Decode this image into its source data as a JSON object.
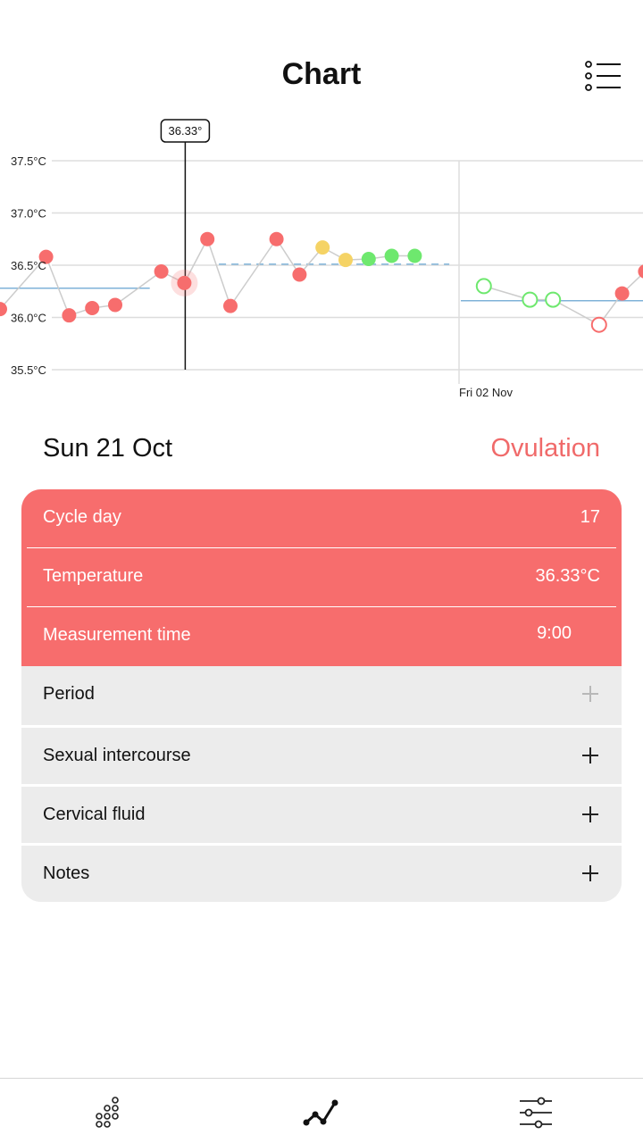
{
  "header": {
    "title": "Chart",
    "menu_icon": "list-menu-icon"
  },
  "chart_data": {
    "type": "scatter",
    "y_tick_labels": [
      "37.5°C",
      "37.0°C",
      "36.5°C",
      "36.0°C",
      "35.5°C"
    ],
    "y_ticks": [
      37.5,
      37.0,
      36.5,
      36.0,
      35.5
    ],
    "ylim": [
      35.5,
      37.7
    ],
    "x_marker_label": "Fri 02 Nov",
    "selected_value_label": "36.33°",
    "selected_day_index": 8,
    "line_x_range": [
      -0.5,
      28.5
    ],
    "series": [
      {
        "points": [
          {
            "d": 0,
            "v": 36.08,
            "s": "period"
          },
          {
            "d": 2,
            "v": 36.58,
            "s": "period"
          },
          {
            "d": 3,
            "v": 36.02,
            "s": "period"
          },
          {
            "d": 4,
            "v": 36.09,
            "s": "period"
          },
          {
            "d": 5,
            "v": 36.12,
            "s": "period"
          },
          {
            "d": 7,
            "v": 36.44,
            "s": "period"
          },
          {
            "d": 8,
            "v": 36.33,
            "s": "period"
          },
          {
            "d": 9,
            "v": 36.75,
            "s": "period"
          },
          {
            "d": 10,
            "v": 36.11,
            "s": "period"
          },
          {
            "d": 12,
            "v": 36.75,
            "s": "period"
          },
          {
            "d": 13,
            "v": 36.41,
            "s": "period"
          },
          {
            "d": 14,
            "v": 36.67,
            "s": "mucus"
          },
          {
            "d": 15,
            "v": 36.55,
            "s": "mucus"
          },
          {
            "d": 16,
            "v": 36.56,
            "s": "fertile"
          },
          {
            "d": 17,
            "v": 36.59,
            "s": "fertile"
          },
          {
            "d": 18,
            "v": 36.59,
            "s": "fertile"
          },
          {
            "d": 21,
            "v": 36.3,
            "s": "predicted-fertile"
          },
          {
            "d": 23,
            "v": 36.17,
            "s": "predicted-fertile"
          },
          {
            "d": 24,
            "v": 36.17,
            "s": "predicted-fertile"
          },
          {
            "d": 26,
            "v": 35.93,
            "s": "predicted-period"
          },
          {
            "d": 27,
            "v": 36.23,
            "s": "period"
          },
          {
            "d": 28,
            "v": 36.44,
            "s": "period"
          }
        ]
      }
    ],
    "baselines": [
      {
        "from_day": -0.5,
        "to_day": 6.5,
        "value": 36.28,
        "style": "solid"
      },
      {
        "from_day": 9.5,
        "to_day": 19.5,
        "value": 36.51,
        "style": "dashed"
      },
      {
        "from_day": 20,
        "to_day": 28.5,
        "value": 36.16,
        "style": "solid"
      }
    ],
    "colors": {
      "period": "#f76d6d",
      "mucus": "#f5d365",
      "fertile": "#6ee86e",
      "baseline": "#7fb2d8",
      "grid": "#dddddd",
      "connect": "#cccccc"
    }
  },
  "details": {
    "date": "Sun 21 Oct",
    "phase": "Ovulation",
    "rows": [
      {
        "label": "Cycle day",
        "value": "17"
      },
      {
        "label": "Temperature",
        "value": "36.33°C"
      },
      {
        "label": "Measurement time",
        "value": "9:00"
      }
    ],
    "add_rows": [
      {
        "label": "Period",
        "icon": "plus-icon"
      },
      {
        "label": "Sexual intercourse",
        "icon": "plus-icon"
      },
      {
        "label": "Cervical fluid",
        "icon": "plus-icon"
      },
      {
        "label": "Notes",
        "icon": "plus-icon"
      }
    ]
  },
  "bottom_nav": {
    "items": [
      {
        "icon": "calendar-dots-icon"
      },
      {
        "icon": "chart-line-icon"
      },
      {
        "icon": "settings-sliders-icon"
      }
    ]
  },
  "colors": {
    "accent": "#f76d6d",
    "card_grey": "#ececec"
  }
}
